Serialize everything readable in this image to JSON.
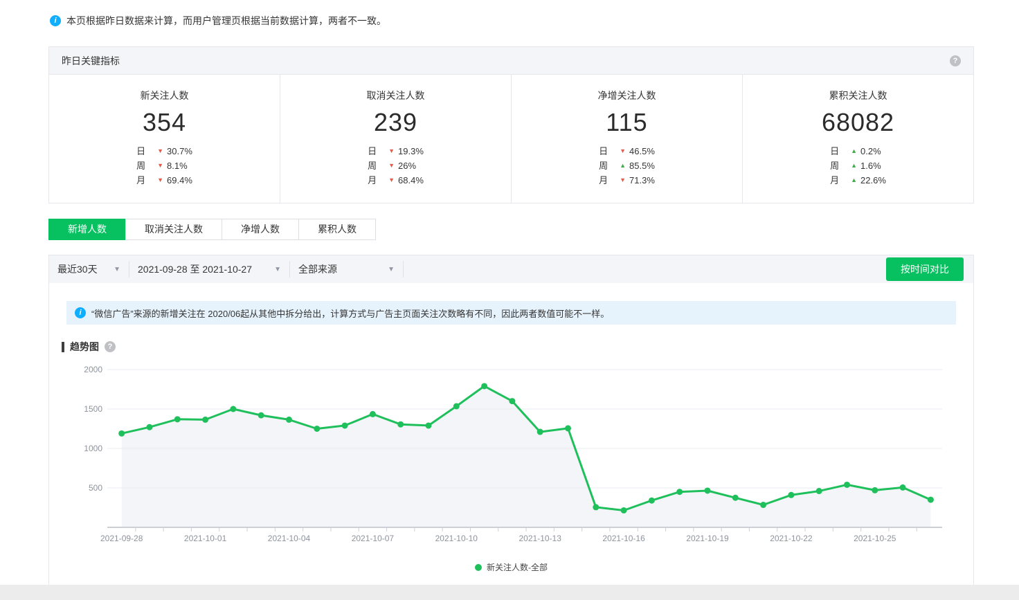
{
  "page_note": "本页根据昨日数据来计算，而用户管理页根据当前数据计算，两者不一致。",
  "yesterday_panel": {
    "title": "昨日关键指标",
    "help_icon": "?",
    "metrics": [
      {
        "label": "新关注人数",
        "value": "354",
        "rows": [
          {
            "period": "日",
            "dir": "down",
            "pct": "30.7%"
          },
          {
            "period": "周",
            "dir": "down",
            "pct": "8.1%"
          },
          {
            "period": "月",
            "dir": "down",
            "pct": "69.4%"
          }
        ]
      },
      {
        "label": "取消关注人数",
        "value": "239",
        "rows": [
          {
            "period": "日",
            "dir": "down",
            "pct": "19.3%"
          },
          {
            "period": "周",
            "dir": "down",
            "pct": "26%"
          },
          {
            "period": "月",
            "dir": "down",
            "pct": "68.4%"
          }
        ]
      },
      {
        "label": "净增关注人数",
        "value": "115",
        "rows": [
          {
            "period": "日",
            "dir": "down",
            "pct": "46.5%"
          },
          {
            "period": "周",
            "dir": "up",
            "pct": "85.5%"
          },
          {
            "period": "月",
            "dir": "down",
            "pct": "71.3%"
          }
        ]
      },
      {
        "label": "累积关注人数",
        "value": "68082",
        "rows": [
          {
            "period": "日",
            "dir": "up",
            "pct": "0.2%"
          },
          {
            "period": "周",
            "dir": "up",
            "pct": "1.6%"
          },
          {
            "period": "月",
            "dir": "up",
            "pct": "22.6%"
          }
        ]
      }
    ]
  },
  "tabs": [
    {
      "label": "新增人数",
      "active": true
    },
    {
      "label": "取消关注人数",
      "active": false
    },
    {
      "label": "净增人数",
      "active": false
    },
    {
      "label": "累积人数",
      "active": false
    }
  ],
  "filters": {
    "range_label": "最近30天",
    "date_range": "2021-09-28 至 2021-10-27",
    "source": "全部来源",
    "compare_button": "按时间对比"
  },
  "notice": "“微信广告”来源的新增关注在 2020/06起从其他中拆分给出，计算方式与广告主页面关注次数略有不同，因此两者数值可能不一样。",
  "trend": {
    "title": "趋势图",
    "help_icon": "?"
  },
  "chart_data": {
    "type": "line",
    "x": [
      "2021-09-28",
      "2021-09-29",
      "2021-09-30",
      "2021-10-01",
      "2021-10-02",
      "2021-10-03",
      "2021-10-04",
      "2021-10-05",
      "2021-10-06",
      "2021-10-07",
      "2021-10-08",
      "2021-10-09",
      "2021-10-10",
      "2021-10-11",
      "2021-10-12",
      "2021-10-13",
      "2021-10-14",
      "2021-10-15",
      "2021-10-16",
      "2021-10-17",
      "2021-10-18",
      "2021-10-19",
      "2021-10-20",
      "2021-10-21",
      "2021-10-22",
      "2021-10-23",
      "2021-10-24",
      "2021-10-25",
      "2021-10-26",
      "2021-10-27"
    ],
    "series": [
      {
        "name": "新关注人数-全部",
        "values": [
          1190,
          1270,
          1370,
          1365,
          1500,
          1420,
          1365,
          1250,
          1290,
          1435,
          1305,
          1290,
          1535,
          1790,
          1600,
          1210,
          1255,
          255,
          215,
          340,
          450,
          465,
          375,
          285,
          410,
          460,
          540,
          470,
          505,
          350
        ]
      }
    ],
    "yticks": [
      500,
      1000,
      1500,
      2000
    ],
    "ylim": [
      0,
      2000
    ],
    "x_label_every": 3,
    "grid": true,
    "legend": [
      "新关注人数-全部"
    ],
    "legend_position": "bottom",
    "line_color": "#1fc05c",
    "area_color": "#f3f5f8",
    "axis_color": "#ccd0d6",
    "grid_color": "#e9ebf0",
    "tick_text_color": "#8d939c"
  }
}
